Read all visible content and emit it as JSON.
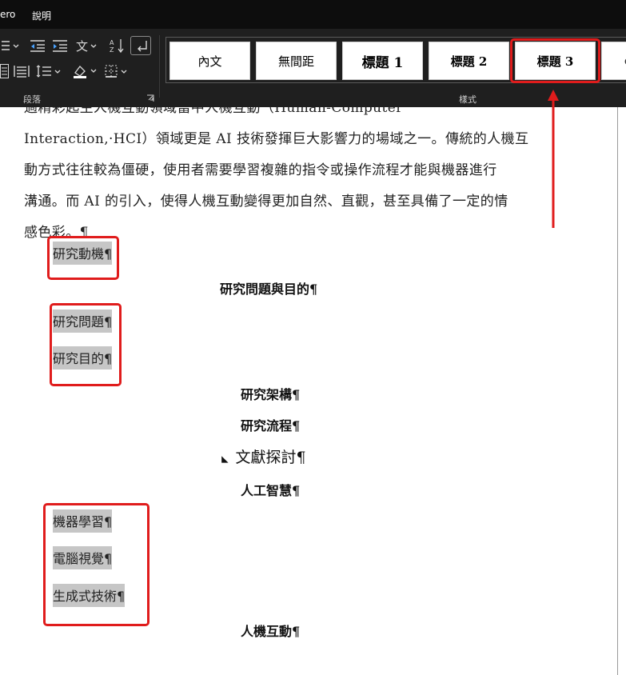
{
  "menubar": {
    "items": [
      "ero",
      "說明"
    ]
  },
  "ribbon": {
    "paragraph_group_label": "段落",
    "styles_group_label": "樣式",
    "styles": [
      {
        "label": "內文",
        "kind": "normal"
      },
      {
        "label": "無間距",
        "kind": "normal"
      },
      {
        "label": "標題 1",
        "kind": "heading1"
      },
      {
        "label": "標題 2",
        "kind": "heading"
      },
      {
        "label": "標題 3",
        "kind": "heading",
        "highlighted": true
      }
    ],
    "icons": {
      "numbering": "numbering-icon",
      "decrease_indent": "decrease-indent-icon",
      "increase_indent": "increase-indent-icon",
      "chinese_layout": "chinese-layout-icon",
      "sort": "sort-icon",
      "show_marks": "show-paragraph-marks-icon",
      "justify": "justify-icon",
      "distributed": "distributed-icon",
      "line_spacing": "line-spacing-icon",
      "shading": "shading-icon",
      "borders": "borders-icon",
      "dialog_launcher": "dialog-launcher-icon"
    }
  },
  "document": {
    "body_lines": [
      "過精彩起生人機互動領域當中人機互動（Human-Computer",
      "Interaction,·HCI）領域更是 AI 技術發揮巨大影響力的場域之一。傳統的人機互",
      "動方式往往較為僵硬，使用者需要學習複雜的指令或操作流程才能與機器進行",
      "溝通。而 AI 的引入，使得人機互動變得更加自然、直觀，甚至具備了一定的情",
      "感色彩。¶"
    ],
    "items": {
      "motivation": "研究動機¶",
      "questions_purpose_heading": "研究問題與目的¶",
      "questions": "研究問題¶",
      "purpose": "研究目的¶",
      "framework": "研究架構¶",
      "process": "研究流程¶",
      "literature": "文獻探討¶",
      "ai": "人工智慧¶",
      "ml": "機器學習¶",
      "cv": "電腦視覺¶",
      "genai": "生成式技術¶",
      "hci": "人機互動¶"
    },
    "collapse_glyph": "◢"
  },
  "colors": {
    "annotation_red": "#e01c1c",
    "highlight_gray": "#c6c6c6",
    "ribbon_bg": "#1f1f1f"
  }
}
